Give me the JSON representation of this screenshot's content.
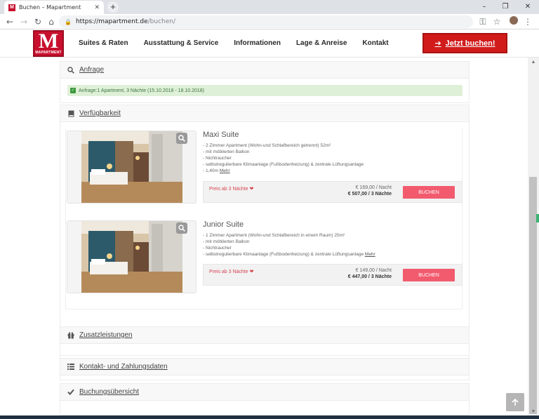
{
  "browser": {
    "tab_title": "Buchen – Mapartment",
    "tab_favicon": "M",
    "url_host": "https://mapartment.de",
    "url_path": "/buchen/"
  },
  "header": {
    "logo_letter": "M",
    "logo_wordmark": "MAPARTMENT",
    "nav": [
      "Suites & Raten",
      "Ausstattung & Service",
      "Informationen",
      "Lage & Anreise",
      "Kontakt"
    ],
    "book_now": "Jetzt buchen!"
  },
  "sections": {
    "anfrage": "Anfrage",
    "availability": "Verfügbarkeit",
    "extras": "Zusatzleistungen",
    "contact": "Kontakt- und Zahlungsdaten",
    "summary": "Buchungsübersicht"
  },
  "alert_text": "Anfrage:1 Apartment, 3 Nächte (15.10.2018 - 18.10.2018)",
  "rooms": [
    {
      "name": "Maxi Suite",
      "desc": [
        "- 2 Zimmer Apartment (Wohn-und Schlafbereich getrennt) 52m²",
        "- mit möblierten Balkon",
        "- Nichtraucher",
        "- selbstregulierbare Klimaanlage (Fußbodenheizung) & zentrale Lüftungsanlage",
        "- 1,40m"
      ],
      "more": "Mehr",
      "price_from": "Preis ab 3 Nächte",
      "per_night": "€ 169,00 / Nacht",
      "total": "€ 507,00 / 3 Nächte",
      "book": "BUCHEN"
    },
    {
      "name": "Junior Suite",
      "desc": [
        "- 1 Zimmer Apartment (Wohn-und Schlafbereich in einem Raum) 25m²",
        "- mit möblierten Balkon",
        "- Nichtraucher",
        "- selbstregulierbare Klimaanlage (Fußbodenheizung) & zentrale Lüftungsanlage"
      ],
      "more": "Mehr",
      "price_from": "Preis ab 3 Nächte",
      "per_night": "€ 149,00 / Nacht",
      "total": "€ 447,00 / 3 Nächte",
      "book": "BUCHEN"
    }
  ],
  "colors": {
    "brand_red": "#c8102e",
    "book_button": "#f25b6e",
    "success_bg": "#dff0d8"
  }
}
